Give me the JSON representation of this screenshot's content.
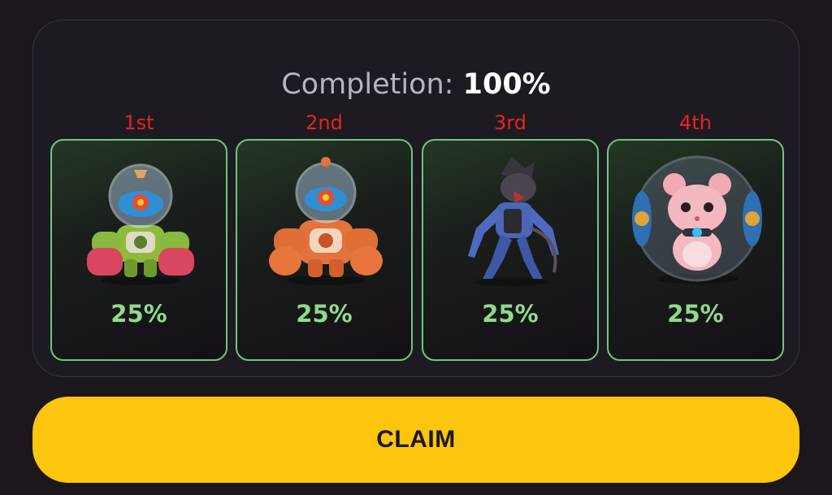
{
  "completion": {
    "label": "Completion:",
    "value": "100%"
  },
  "cards": [
    {
      "rank": "1st",
      "percent": "25%",
      "character": "green-mech-robot"
    },
    {
      "rank": "2nd",
      "percent": "25%",
      "character": "orange-mech-robot"
    },
    {
      "rank": "3rd",
      "percent": "25%",
      "character": "blue-cyborg-rat"
    },
    {
      "rank": "4th",
      "percent": "25%",
      "character": "hamster-in-ball"
    }
  ],
  "claim_button": {
    "label": "CLAIM"
  },
  "colors": {
    "background": "#1b171d",
    "card_border": "#6ec77c",
    "percent_text": "#8fdb8b",
    "rank_text": "#e3261c",
    "claim_button": "#fcc50e"
  }
}
